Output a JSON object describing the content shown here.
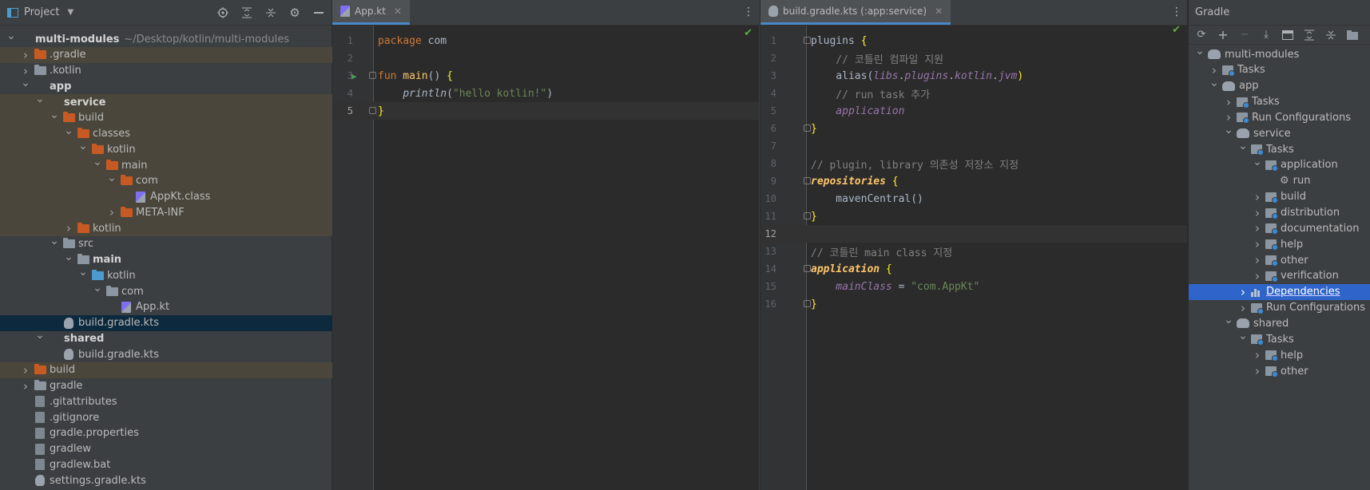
{
  "project_panel": {
    "title": "Project",
    "tree": [
      {
        "label": "multi-modules",
        "hint": "~/Desktop/kotlin/multi-modules",
        "depth": 0,
        "arrow": "down",
        "icon": "folder-module",
        "bold": true
      },
      {
        "label": ".gradle",
        "depth": 1,
        "arrow": "right",
        "icon": "folder-orange",
        "excluded": true
      },
      {
        "label": ".kotlin",
        "depth": 1,
        "arrow": "right",
        "icon": "folder-gray"
      },
      {
        "label": "app",
        "depth": 1,
        "arrow": "down",
        "icon": "folder-module",
        "bold": true
      },
      {
        "label": "service",
        "depth": 2,
        "arrow": "down",
        "icon": "folder-module",
        "bold": true,
        "excluded": true
      },
      {
        "label": "build",
        "depth": 3,
        "arrow": "down",
        "icon": "folder-orange",
        "excluded": true
      },
      {
        "label": "classes",
        "depth": 4,
        "arrow": "down",
        "icon": "folder-orange",
        "excluded": true
      },
      {
        "label": "kotlin",
        "depth": 5,
        "arrow": "down",
        "icon": "folder-orange",
        "excluded": true
      },
      {
        "label": "main",
        "depth": 6,
        "arrow": "down",
        "icon": "folder-orange",
        "excluded": true
      },
      {
        "label": "com",
        "depth": 7,
        "arrow": "down",
        "icon": "folder-orange",
        "excluded": true
      },
      {
        "label": "AppKt.class",
        "depth": 8,
        "arrow": "",
        "icon": "file-kt",
        "excluded": true
      },
      {
        "label": "META-INF",
        "depth": 7,
        "arrow": "right",
        "icon": "folder-orange",
        "excluded": true
      },
      {
        "label": "kotlin",
        "depth": 4,
        "arrow": "right",
        "icon": "folder-orange",
        "excluded": true
      },
      {
        "label": "src",
        "depth": 3,
        "arrow": "down",
        "icon": "folder-gray"
      },
      {
        "label": "main",
        "depth": 4,
        "arrow": "down",
        "icon": "folder-gray",
        "bold": true
      },
      {
        "label": "kotlin",
        "depth": 5,
        "arrow": "down",
        "icon": "folder-blue"
      },
      {
        "label": "com",
        "depth": 6,
        "arrow": "down",
        "icon": "folder-gray"
      },
      {
        "label": "App.kt",
        "depth": 7,
        "arrow": "",
        "icon": "file-kt"
      },
      {
        "label": "build.gradle.kts",
        "depth": 3,
        "arrow": "",
        "icon": "file-gradle",
        "selected": true
      },
      {
        "label": "shared",
        "depth": 2,
        "arrow": "down",
        "icon": "folder-module",
        "bold": true
      },
      {
        "label": "build.gradle.kts",
        "depth": 3,
        "arrow": "",
        "icon": "file-gradle"
      },
      {
        "label": "build",
        "depth": 1,
        "arrow": "right",
        "icon": "folder-orange",
        "excluded": true
      },
      {
        "label": "gradle",
        "depth": 1,
        "arrow": "right",
        "icon": "folder-gray"
      },
      {
        "label": ".gitattributes",
        "depth": 1,
        "arrow": "",
        "icon": "file-text"
      },
      {
        "label": ".gitignore",
        "depth": 1,
        "arrow": "",
        "icon": "file-text"
      },
      {
        "label": "gradle.properties",
        "depth": 1,
        "arrow": "",
        "icon": "file-text"
      },
      {
        "label": "gradlew",
        "depth": 1,
        "arrow": "",
        "icon": "file-text"
      },
      {
        "label": "gradlew.bat",
        "depth": 1,
        "arrow": "",
        "icon": "file-text"
      },
      {
        "label": "settings.gradle.kts",
        "depth": 1,
        "arrow": "",
        "icon": "file-gradle"
      }
    ]
  },
  "editor1": {
    "tab_label": "App.kt",
    "lines": [
      "1",
      "2",
      "3",
      "4",
      "5"
    ],
    "code": {
      "l1_kw": "package",
      "l1_rest": " com",
      "l3_kw": "fun",
      "l3_fn": " main",
      "l3_paren": "() ",
      "l3_brace": "{",
      "l4_indent": "    ",
      "l4_call": "println",
      "l4_open": "(",
      "l4_str": "\"hello kotlin!\"",
      "l4_close": ")",
      "l5_brace": "}"
    }
  },
  "editor2": {
    "tab_label": "build.gradle.kts (:app:service)",
    "lines": [
      "1",
      "2",
      "3",
      "4",
      "5",
      "6",
      "7",
      "8",
      "9",
      "10",
      "11",
      "12",
      "13",
      "14",
      "15",
      "16"
    ],
    "code": {
      "l1_a": "plugins",
      "l1_b": " {",
      "l2": "    // 코틀린 컴파일 지원",
      "l3_a": "    alias(",
      "l3_b": "libs",
      "l3_c": ".",
      "l3_d": "plugins",
      "l3_e": ".",
      "l3_f": "kotlin",
      "l3_g": ".",
      "l3_h": "jvm",
      "l3_i": ")",
      "l4": "    // run task 추가",
      "l5": "    application",
      "l6": "}",
      "l8": "// plugin, library 의존성 저장소 지정",
      "l9_a": "repositories",
      "l9_b": " {",
      "l10": "    mavenCentral()",
      "l11": "}",
      "l13": "// 코틀린 main class 지정",
      "l14_a": "application",
      "l14_b": " {",
      "l15_a": "    mainClass",
      "l15_b": " = ",
      "l15_c": "\"com.AppKt\"",
      "l16": "}"
    }
  },
  "gradle_panel": {
    "title": "Gradle",
    "tree": [
      {
        "label": "multi-modules",
        "depth": 0,
        "arrow": "down",
        "icon": "elephant"
      },
      {
        "label": "Tasks",
        "depth": 1,
        "arrow": "right",
        "icon": "task"
      },
      {
        "label": "app",
        "depth": 1,
        "arrow": "down",
        "icon": "elephant"
      },
      {
        "label": "Tasks",
        "depth": 2,
        "arrow": "right",
        "icon": "task"
      },
      {
        "label": "Run Configurations",
        "depth": 2,
        "arrow": "right",
        "icon": "task"
      },
      {
        "label": "service",
        "depth": 2,
        "arrow": "down",
        "icon": "elephant"
      },
      {
        "label": "Tasks",
        "depth": 3,
        "arrow": "down",
        "icon": "task"
      },
      {
        "label": "application",
        "depth": 4,
        "arrow": "down",
        "icon": "task"
      },
      {
        "label": "run",
        "depth": 5,
        "arrow": "",
        "icon": "gear"
      },
      {
        "label": "build",
        "depth": 4,
        "arrow": "right",
        "icon": "task"
      },
      {
        "label": "distribution",
        "depth": 4,
        "arrow": "right",
        "icon": "task"
      },
      {
        "label": "documentation",
        "depth": 4,
        "arrow": "right",
        "icon": "task"
      },
      {
        "label": "help",
        "depth": 4,
        "arrow": "right",
        "icon": "task"
      },
      {
        "label": "other",
        "depth": 4,
        "arrow": "right",
        "icon": "task"
      },
      {
        "label": "verification",
        "depth": 4,
        "arrow": "right",
        "icon": "task"
      },
      {
        "label": "Dependencies",
        "depth": 3,
        "arrow": "right",
        "icon": "deps",
        "selected": true
      },
      {
        "label": "Run Configurations",
        "depth": 3,
        "arrow": "right",
        "icon": "task"
      },
      {
        "label": "shared",
        "depth": 2,
        "arrow": "down",
        "icon": "elephant"
      },
      {
        "label": "Tasks",
        "depth": 3,
        "arrow": "down",
        "icon": "task"
      },
      {
        "label": "help",
        "depth": 4,
        "arrow": "right",
        "icon": "task"
      },
      {
        "label": "other",
        "depth": 4,
        "arrow": "right",
        "icon": "task"
      }
    ]
  },
  "colors": {
    "selection_gradle": "#2f65ca",
    "selection_project": "#0d293e",
    "excluded_bg": "#4a463b",
    "accent": "#4a88c7"
  }
}
